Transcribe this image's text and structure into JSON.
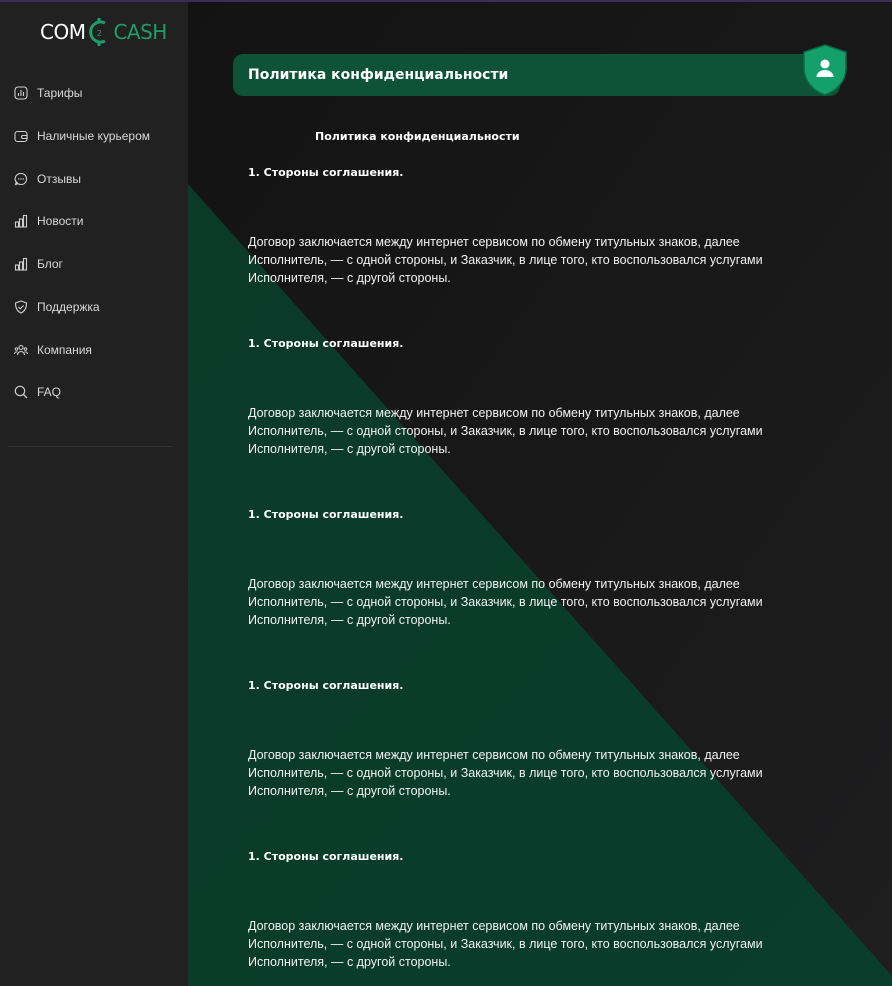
{
  "logo": {
    "part1": "COM",
    "part2": "CASH",
    "mark": "2"
  },
  "sidebar": {
    "items": [
      {
        "label": "Тарифы",
        "icon": "chart-icon"
      },
      {
        "label": "Наличные курьером",
        "icon": "wallet-icon"
      },
      {
        "label": "Отзывы",
        "icon": "chat-icon"
      },
      {
        "label": "Новости",
        "icon": "bar-chart-icon"
      },
      {
        "label": "Блог",
        "icon": "bar-chart-icon"
      },
      {
        "label": "Поддержка",
        "icon": "shield-check-icon"
      },
      {
        "label": "Компания",
        "icon": "users-icon"
      },
      {
        "label": "FAQ",
        "icon": "search-icon"
      }
    ]
  },
  "page": {
    "title": "Политика конфиденциальности",
    "doc_title": "Политика конфиденциальности",
    "sections": [
      {
        "heading": "1. Стороны соглашения.",
        "text": "Договор заключается между интернет сервисом по обмену титульных знаков, далее Исполнитель, — с одной стороны, и Заказчик, в лице того, кто воспользовался услугами Исполнителя, — с другой стороны."
      },
      {
        "heading": "1. Стороны соглашения.",
        "text": "Договор заключается между интернет сервисом по обмену титульных знаков, далее Исполнитель, — с одной стороны, и Заказчик, в лице того, кто воспользовался услугами Исполнителя, — с другой стороны."
      },
      {
        "heading": "1. Стороны соглашения.",
        "text": "Договор заключается между интернет сервисом по обмену титульных знаков, далее Исполнитель, — с одной стороны, и Заказчик, в лице того, кто воспользовался услугами Исполнителя, — с другой стороны."
      },
      {
        "heading": "1. Стороны соглашения.",
        "text": "Договор заключается между интернет сервисом по обмену титульных знаков, далее Исполнитель, — с одной стороны, и Заказчик, в лице того, кто воспользовался услугами Исполнителя, — с другой стороны."
      },
      {
        "heading": "1. Стороны соглашения.",
        "text": "Договор заключается между интернет сервисом по обмену титульных знаков, далее Исполнитель, — с одной стороны, и Заказчик, в лице того, кто воспользовался услугами Исполнителя, — с другой стороны."
      }
    ]
  },
  "colors": {
    "accent": "#1f9d6b",
    "title_bar": "#0e5337",
    "diagonal_green": "#0b3a2a",
    "sidebar_bg": "#212121",
    "main_bg": "#1a1a1a"
  }
}
